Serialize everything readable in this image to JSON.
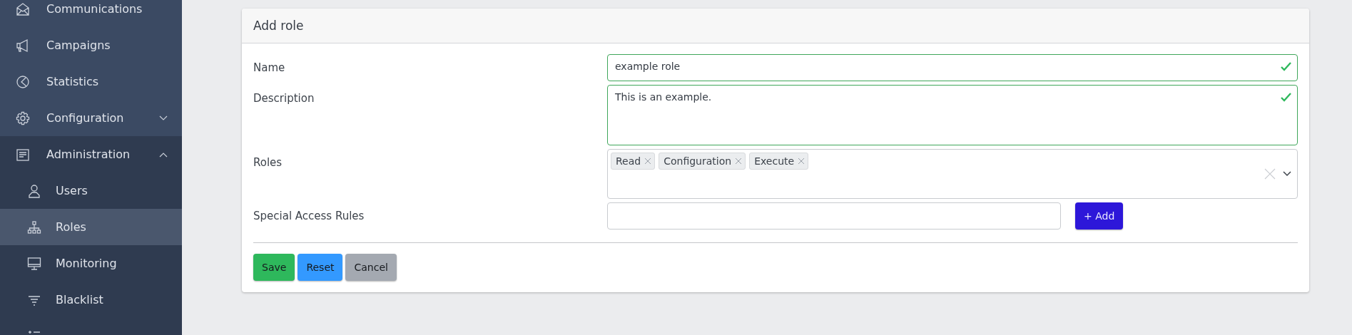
{
  "sidebar": {
    "items": [
      {
        "label": "Communications",
        "selected": false
      },
      {
        "label": "Campaigns",
        "selected": false
      },
      {
        "label": "Statistics",
        "selected": false
      },
      {
        "label": "Configuration",
        "selected": false,
        "expanded": false
      },
      {
        "label": "Administration",
        "selected": false,
        "expanded": true,
        "children": [
          {
            "label": "Users",
            "selected": false
          },
          {
            "label": "Roles",
            "selected": true
          },
          {
            "label": "Monitoring",
            "selected": false
          },
          {
            "label": "Blacklist",
            "selected": false
          },
          {
            "selected": false
          }
        ]
      }
    ]
  },
  "card": {
    "title": "Add role",
    "fields": [
      {
        "kind": "text",
        "label": "Name",
        "value": "example role",
        "valid": true
      },
      {
        "kind": "textarea",
        "label": "Description",
        "value": "This is an example.",
        "valid": true
      },
      {
        "kind": "tags",
        "label": "Roles",
        "tags": [
          "Read",
          "Configuration",
          "Execute"
        ]
      },
      {
        "kind": "addable",
        "label": "Special Access Rules",
        "button": "+ Add"
      }
    ],
    "buttons": [
      {
        "label": "Save",
        "kind": "save"
      },
      {
        "label": "Reset",
        "kind": "reset"
      },
      {
        "label": "Cancel",
        "kind": "cancel"
      }
    ]
  }
}
